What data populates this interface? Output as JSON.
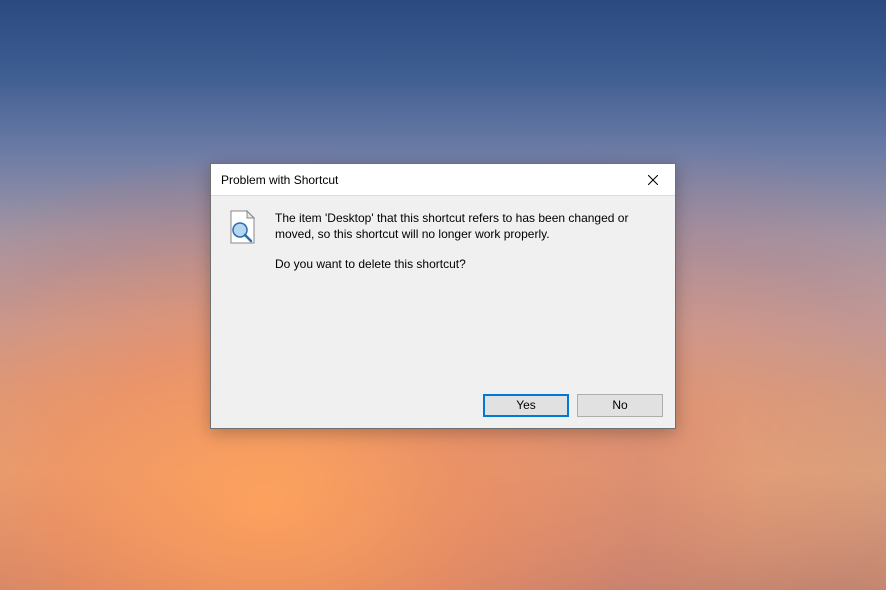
{
  "dialog": {
    "title": "Problem with Shortcut",
    "message_line1": "The item 'Desktop' that this shortcut refers to has been changed or moved, so this shortcut will no longer work properly.",
    "message_line2": "Do you want to delete this shortcut?",
    "yes_label": "Yes",
    "no_label": "No"
  }
}
